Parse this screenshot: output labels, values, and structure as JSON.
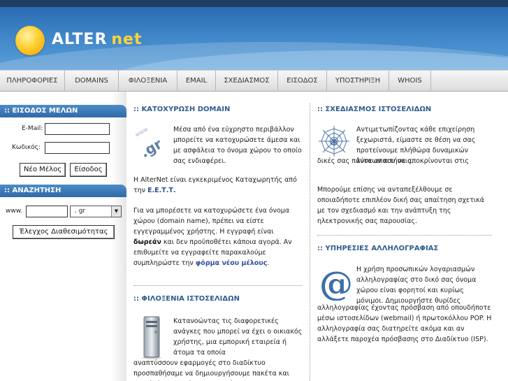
{
  "brand": {
    "name": "ALTER",
    "suffix": "net"
  },
  "nav": [
    "ΠΛΗΡΟΦΟΡΙΕΣ",
    "DOMAINS",
    "ΦΙΛΟΞΕΝΙΑ",
    "EMAIL",
    "ΣΧΕΔΙΑΣΜΟΣ",
    "ΕΙΣΟΔΟΣ",
    "ΥΠΟΣΤΗΡΙΞΗ",
    "WHOIS"
  ],
  "login": {
    "title": ":: ΕΙΣΟΔΟΣ ΜΕΛΩΝ",
    "email_label": "E-Mail:",
    "code_label": "Κωδικός:",
    "new_member": "Νέο Μέλος",
    "enter": "Είσοδος"
  },
  "search": {
    "title": ":: ΑΝΑΖΗΤΗΣΗ",
    "www_label": "www.",
    "tld_selected": ". gr",
    "check_button": "Έλεγχος Διαθεσιμότητας"
  },
  "domain": {
    "title": ":: ΚΑΤΟΧΥΡΩΣΗ DOMAIN",
    "intro": "Μέσα από ένα εύχρηστο περιβάλλον μπορείτε να κατοχυρώσετε άμεσα και με ασφάλεια το όνομα χώρου το οποίο σας ενδιαφέρει.",
    "approved_pre": "Η AlterNet είναι εγκεκριμένος Καταχωρητής από την ",
    "approved_link": "Ε.Ε.Τ.Τ.",
    "approved_post": "",
    "body_1": "Για να μπορέσετε να κατοχυρώσετε ένα όνομα χώρου (domain name), πρέπει να είστε εγγεγραμμένος χρήστης. Η εγγραφή είναι ",
    "body_bold": "δωρεάν",
    "body_2": " και δεν προϋποθέτει κάποια αγορά. Αν επιθυμείτε να εγγραφείτε παρακαλούμε συμπληρώστε την ",
    "body_link": "φόρμα νέου μέλους",
    "body_end": "."
  },
  "hosting": {
    "title": ":: ΦΙΛΟΞΕΝΙΑ ΙΣΤΟΣΕΛΙΔΩΝ",
    "text_a": "Κατανοώντας τις διαφορετικές ανάγκες που μπορεί να έχει ο οικιακός χρήστης, μια εμπορική εταιρεία ή άτομα τα οποία",
    "text_b": "αναπτύσσουν εφαρμογές στο διαδίκτυο προσπαθήσαμε να δημιουργήσουμε πακέτα και εργαλεία τα οποία ανταποκρίνονται στις"
  },
  "design": {
    "title": ":: ΣΧΕΔΙΑΣΜΟΣ ΙΣΤΟΣΕΛΙΔΩΝ",
    "text_a": "Αντιμετωπίζοντας κάθε επιχείρηση ξεχωριστά, είμαστε σε θέση να σας προτείνουμε πλήθώρα δυναμικών λύσεων που να αποκρίνονται στις",
    "text_b": "δικές σας πάντα απαιτήσεις.",
    "text_c": "Μπορούμε επίσης να ανταπεξέλθουμε σε οποιαδήποτε επιπλέον δική σας απαίτηση σχετικά με τον σχεδιασμό και την ανάπτυξη της ηλεκτρονικής σας παρουσίας."
  },
  "mail": {
    "title": ":: ΥΠΗΡΕΣΙΕΣ ΑΛΛΗΛΟΓΡΑΦΙΑΣ",
    "text_a": "Η χρήση προσωπικών λογαριασμών αλληλογραφίας στο δικό σας όνομα χώρου είναι φορητοί και κυρίως μόνιμοι. Δημιουργήστε θυρίδες",
    "text_b": "αλληλογραφίας έχοντας πρόσβαση από οπουδήποτε μέσω ιστοσελίδων (webmail) ή πρωτοκόλλου POP. Η αλληλογραφία σας διατηρείτε ακόμα και αν αλλάξετε παροχέα πρόσβασης στο Διαδίκτυο (ISP)."
  },
  "icons": {
    "domain": "gr-domain-icon",
    "hosting": "server-icon",
    "design": "spider-web-icon",
    "mail": "at-sign-icon"
  },
  "icon_text": {
    "gr": ".gr",
    "www": "www"
  },
  "colors": {
    "accent": "#2f5d8f",
    "header": "#3f86c9",
    "sidebar_head": "#2f6aa8",
    "logo_net": "#ffd23a"
  }
}
